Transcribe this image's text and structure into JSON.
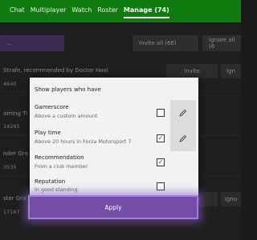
{
  "header": {
    "tabs": [
      "Chat",
      "Multiplayer",
      "Watch",
      "Roster",
      "Manage (74)"
    ],
    "active_index": 4,
    "accent": "#107c10"
  },
  "background": {
    "filter_button": "...",
    "invite_all": "Invite all (66)",
    "ignore_all": "Ignore all (6",
    "rows": [
      {
        "name": "Strafe, recommended by Doctor Hool",
        "num": "4640",
        "action": "Invite",
        "action2": "Ign"
      },
      {
        "name": "aming Ti",
        "num": "14265",
        "action": "",
        "action2": ""
      },
      {
        "name": "nder Gra",
        "num": "3535",
        "action": "",
        "action2": ""
      },
      {
        "name": "ster Gra",
        "num": "17167",
        "action": "Invite",
        "action2": "Igno"
      }
    ]
  },
  "dialog": {
    "title": "Show players who have",
    "options": [
      {
        "name": "Gamerscore",
        "desc": "Above a custom amount",
        "checked": false,
        "editable": true
      },
      {
        "name": "Play time",
        "desc": "Above 20 hours in Forza Motorsport 7",
        "checked": true,
        "editable": true
      },
      {
        "name": "Recommendation",
        "desc": "From a club member",
        "checked": true,
        "editable": false
      },
      {
        "name": "Reputation",
        "desc": "In good standing",
        "checked": false,
        "editable": false
      }
    ],
    "apply_label": "Apply",
    "apply_color": "#744da9",
    "edit_icon": "pencil-icon",
    "check_glyph": "✓"
  }
}
